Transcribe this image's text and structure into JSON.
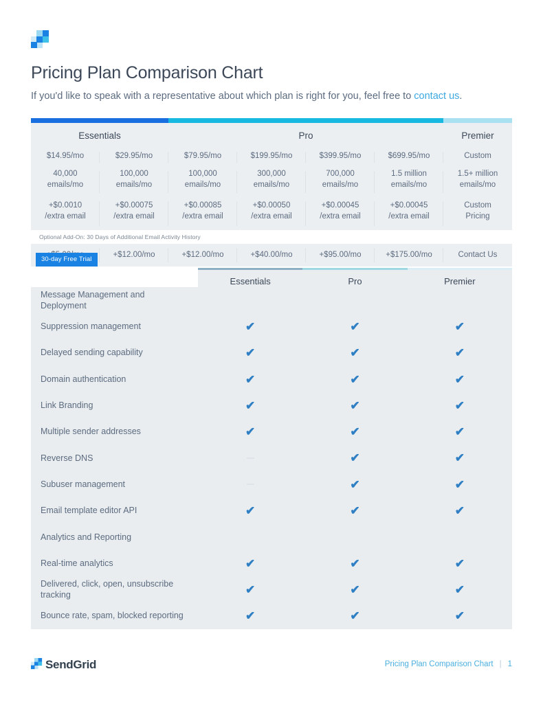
{
  "header": {
    "logo_icon": "sendgrid-square-logo-icon",
    "title": "Pricing Plan Comparison Chart",
    "subtitle_prefix": "If you'd like to speak with a representative about which plan is right for you, feel free to ",
    "subtitle_link": "contact us",
    "subtitle_suffix": "."
  },
  "pricing_table": {
    "tiers": [
      {
        "name": "Essentials",
        "bar_color": "#1a6fe0",
        "span": 2
      },
      {
        "name": "Pro",
        "bar_color": "#18b9e0",
        "span": 4
      },
      {
        "name": "Premier",
        "bar_color": "#a9e0f2",
        "span": 1
      }
    ],
    "rows": {
      "monthly_price": [
        "$14.95/mo",
        "$29.95/mo",
        "$79.95/mo",
        "$199.95/mo",
        "$399.95/mo",
        "$699.95/mo",
        "Custom"
      ],
      "volume_top": [
        "40,000",
        "100,000",
        "100,000",
        "300,000",
        "700,000",
        "1.5 million",
        "1.5+ million"
      ],
      "volume_bottom": [
        "emails/mo",
        "emails/mo",
        "emails/mo",
        "emails/mo",
        "emails/mo",
        "emails/mo",
        "emails/mo"
      ],
      "extra_top": [
        "+$0.0010",
        "+$0.00075",
        "+$0.00085",
        "+$0.00050",
        "+$0.00045",
        "+$0.00045",
        "Custom"
      ],
      "extra_bottom": [
        "/extra email",
        "/extra email",
        "/extra email",
        "/extra email",
        "/extra email",
        "/extra email",
        "Pricing"
      ],
      "addon_prices": [
        "+$5.00/mo",
        "+$12.00/mo",
        "+$12.00/mo",
        "+$40.00/mo",
        "+$95.00/mo",
        "+$175.00/mo",
        "Contact Us"
      ]
    },
    "addon_note": "Optional Add-On: 30 Days of Additional Email Activity History",
    "trial_badge": "30-day Free Trial"
  },
  "feature_table": {
    "columns": [
      "Essentials",
      "Pro",
      "Premier"
    ],
    "column_bar_colors": [
      "#8fb0c4",
      "#9fd8e3",
      "#dceef5"
    ],
    "check_icon": "checkmark-icon",
    "unavailable_icon": "dash-icon",
    "rows": [
      {
        "label": "Message Management and Deployment",
        "type": "group",
        "values": [
          "",
          "",
          ""
        ]
      },
      {
        "label": "Suppression management",
        "type": "feature",
        "values": [
          "check",
          "check",
          "check"
        ]
      },
      {
        "label": "Delayed sending capability",
        "type": "feature",
        "values": [
          "check",
          "check",
          "check"
        ]
      },
      {
        "label": "Domain authentication",
        "type": "feature",
        "values": [
          "check",
          "check",
          "check"
        ]
      },
      {
        "label": "Link Branding",
        "type": "feature",
        "values": [
          "check",
          "check",
          "check"
        ]
      },
      {
        "label": "Multiple sender addresses",
        "type": "feature",
        "values": [
          "check",
          "check",
          "check"
        ]
      },
      {
        "label": "Reverse DNS",
        "type": "feature",
        "values": [
          "dash",
          "check",
          "check"
        ]
      },
      {
        "label": "Subuser management",
        "type": "feature",
        "values": [
          "dash",
          "check",
          "check"
        ]
      },
      {
        "label": "Email template editor API",
        "type": "feature",
        "values": [
          "check",
          "check",
          "check"
        ]
      },
      {
        "label": "Analytics and Reporting",
        "type": "group",
        "values": [
          "",
          "",
          ""
        ]
      },
      {
        "label": "Real-time analytics",
        "type": "feature",
        "values": [
          "check",
          "check",
          "check"
        ]
      },
      {
        "label": "Delivered, click, open, unsubscribe tracking",
        "type": "feature",
        "values": [
          "check",
          "check",
          "check"
        ]
      },
      {
        "label": "Bounce rate, spam, blocked reporting",
        "type": "feature",
        "values": [
          "check",
          "check",
          "check"
        ]
      }
    ]
  },
  "footer": {
    "logo_icon": "sendgrid-square-logo-icon",
    "brand": "SendGrid",
    "doc_title": "Pricing Plan Comparison Chart",
    "divider": "|",
    "page_number": "1"
  },
  "colors": {
    "brand_blue": "#1a82e2",
    "accent_cyan": "#18b9e0",
    "panel_gray": "#e9edf0",
    "price_panel_gray": "#eceff2",
    "text_dark": "#3c4858",
    "text_muted": "#5c6b7f",
    "link_blue": "#3ca8e0",
    "check_blue": "#2f7fc4"
  }
}
